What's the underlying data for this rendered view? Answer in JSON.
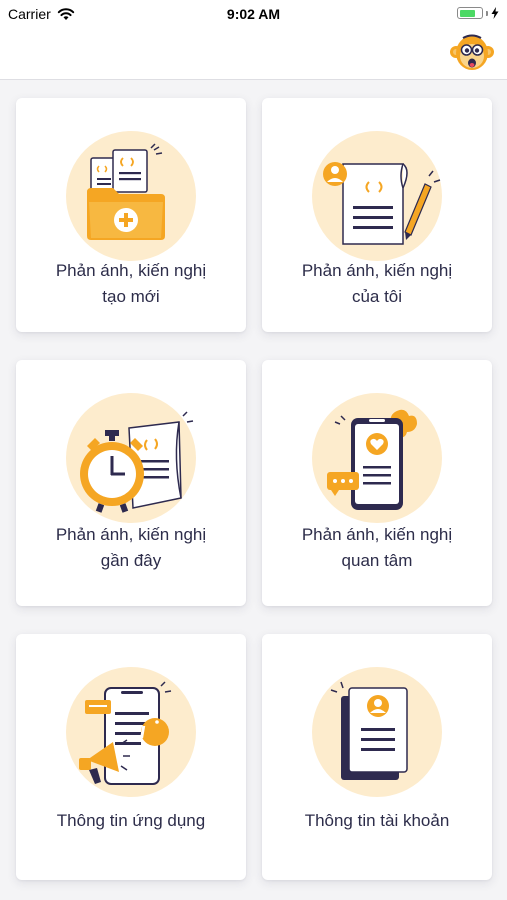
{
  "status_bar": {
    "carrier": "Carrier",
    "time": "9:02 AM",
    "battery_level": 0.75,
    "battery_color": "#4cd964"
  },
  "header": {
    "mascot_icon": "monkey-avatar-icon"
  },
  "menu": {
    "items": [
      {
        "line1": "Phản ánh, kiến nghị",
        "line2": "tạo mới",
        "icon": "folder-add-icon"
      },
      {
        "line1": "Phản ánh, kiến nghị",
        "line2": "của tôi",
        "icon": "document-pen-icon"
      },
      {
        "line1": "Phản ánh, kiến nghị",
        "line2": "gần đây",
        "icon": "stopwatch-document-icon"
      },
      {
        "line1": "Phản ánh, kiến nghị",
        "line2": "quan tâm",
        "icon": "phone-heart-icon"
      },
      {
        "line1": "Thông tin ứng dụng",
        "line2": "",
        "icon": "phone-megaphone-info-icon"
      },
      {
        "line1": "Thông tin tài khoản",
        "line2": "",
        "icon": "account-profile-icon"
      }
    ]
  },
  "colors": {
    "accent": "#f5a623",
    "circle_bg": "#fdeccd",
    "navy": "#2e2a4f",
    "text": "#2d2d4a"
  }
}
